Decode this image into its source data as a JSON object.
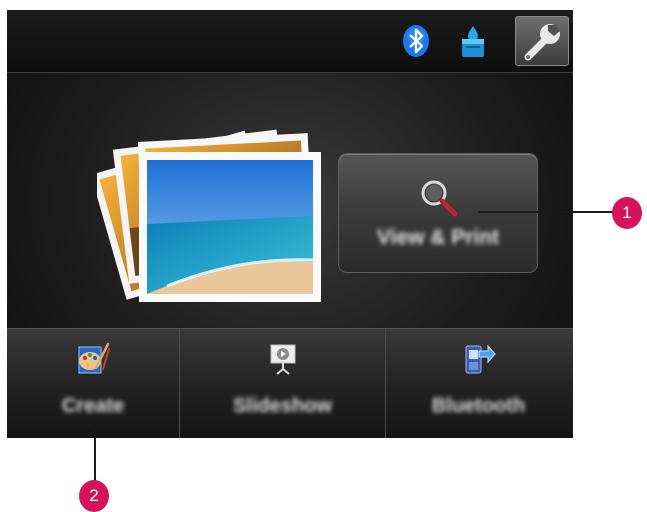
{
  "top_bar": {
    "icons": [
      "bluetooth-icon",
      "ink-level-icon",
      "settings-wrench-icon"
    ]
  },
  "main": {
    "image": "stacked-photos-beach-image",
    "view_print_button": {
      "label": "View & Print",
      "icon": "magnifier-icon"
    }
  },
  "bottom_bar": {
    "buttons": [
      {
        "label": "Create",
        "icon": "palette-icon"
      },
      {
        "label": "Slideshow",
        "icon": "projector-screen-icon"
      },
      {
        "label": "Bluetooth",
        "icon": "phone-transfer-icon"
      }
    ]
  },
  "callouts": [
    "1",
    "2"
  ],
  "colors": {
    "callout": "#d4145a",
    "screen_bg": "#1c1c1c",
    "bluetooth_blue": "#1a78e8"
  }
}
